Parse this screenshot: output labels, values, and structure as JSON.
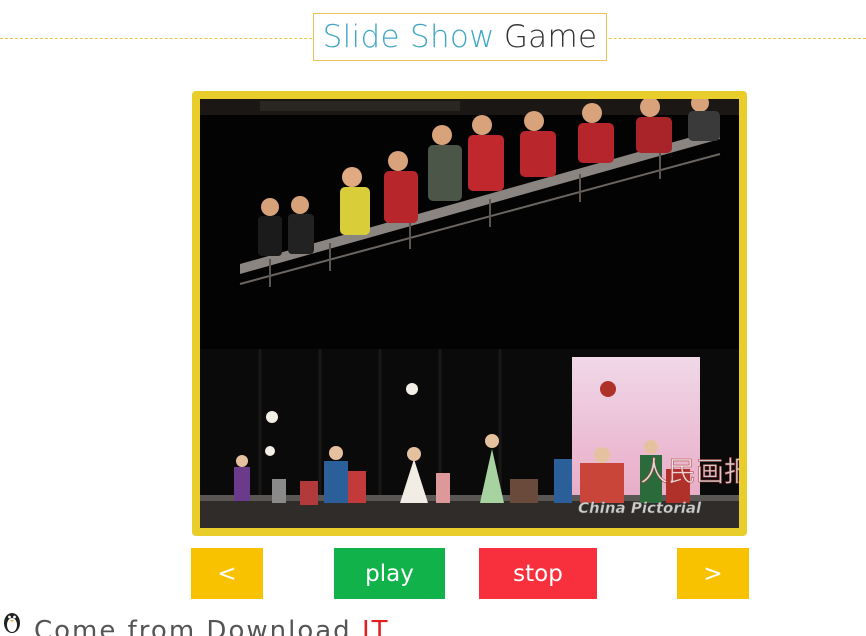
{
  "header": {
    "title_part1": "Slide Show",
    "title_part2": "Game"
  },
  "slide": {
    "watermark_cn": "人民画报",
    "watermark_en": "China Pictorial",
    "icon": "puppet-show-photo"
  },
  "controls": {
    "prev_label": "<",
    "play_label": "play",
    "stop_label": "stop",
    "next_label": ">"
  },
  "footer": {
    "text": "Come from Download",
    "accent": "IT"
  },
  "colors": {
    "accent_blue": "#3fa7c4",
    "frame_yellow": "#e8cd2b",
    "nav_yellow": "#f9c200",
    "play_green": "#12b24a",
    "stop_red": "#f8303d"
  }
}
